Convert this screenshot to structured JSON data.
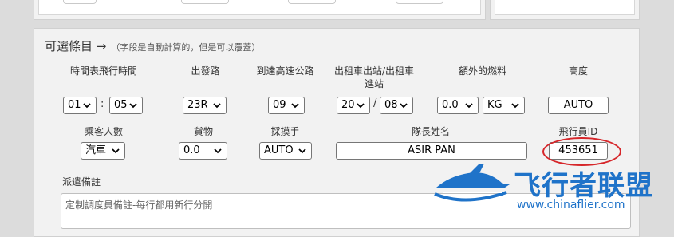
{
  "section": {
    "title": "可選條目 →",
    "note": "（字段是自動計算的，但是可以覆蓋）"
  },
  "row1": {
    "labels": {
      "schedule_time": "時間表飛行時間",
      "departure_runway": "出發路",
      "arrival_runway": "到達高速公路",
      "taxi": "出租車出站/出租車進站",
      "extra_fuel": "額外的燃料",
      "altitude": "高度"
    },
    "values": {
      "hours": "01",
      "time_sep": ":",
      "minutes": "05",
      "departure_runway": "23R",
      "arrival_runway": "09",
      "taxi_out": "20",
      "taxi_sep": "/",
      "taxi_in": "08",
      "extra_fuel": "0.0",
      "fuel_unit": "KG",
      "altitude": "AUTO"
    }
  },
  "row2": {
    "labels": {
      "passengers": "乘客人數",
      "cargo": "貨物",
      "pilot_mode": "採摸手",
      "captain_name": "隊長姓名",
      "pilot_id": "飛行員ID"
    },
    "values": {
      "passengers": "汽車",
      "cargo": "0.0",
      "pilot_mode": "AUTO",
      "captain_name": "ASIR PAN",
      "pilot_id": "453651"
    }
  },
  "dispatch": {
    "label": "派遣備註",
    "placeholder": "定制調度員備註-每行都用新行分開"
  },
  "watermark": {
    "brand": "飞行者联盟",
    "url": "www.chinaflier.com"
  },
  "colors": {
    "annotation_circle": "#d6262a",
    "watermark_blue": "#1f73c9"
  }
}
